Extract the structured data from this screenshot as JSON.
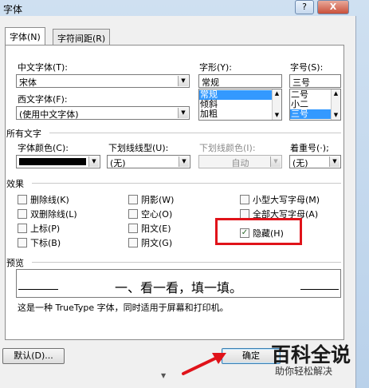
{
  "window": {
    "title": "字体",
    "help_button": "?",
    "close_button": "X"
  },
  "tabs": [
    {
      "label": "字体(N)",
      "active": true
    },
    {
      "label": "字符间距(R)",
      "active": false
    }
  ],
  "font": {
    "chinese_font_label": "中文字体(T):",
    "chinese_font_value": "宋体",
    "western_font_label": "西文字体(F):",
    "western_font_value": "(使用中文字体)",
    "style_label": "字形(Y):",
    "style_value": "常规",
    "style_options": [
      "常规",
      "倾斜",
      "加粗"
    ],
    "style_selected": 0,
    "size_label": "字号(S):",
    "size_value": "三号",
    "size_options": [
      "二号",
      "小二",
      "三号"
    ],
    "size_selected": 2
  },
  "all_text": {
    "section_label": "所有文字",
    "font_color_label": "字体颜色(C):",
    "font_color_value": "#000000",
    "underline_style_label": "下划线线型(U):",
    "underline_style_value": "(无)",
    "underline_color_label": "下划线颜色(I):",
    "underline_color_value": "自动",
    "emphasis_label": "着重号(·);",
    "emphasis_value": "(无)"
  },
  "effects": {
    "section_label": "效果",
    "items": [
      {
        "label": "删除线(K)",
        "checked": false
      },
      {
        "label": "双删除线(L)",
        "checked": false
      },
      {
        "label": "上标(P)",
        "checked": false
      },
      {
        "label": "下标(B)",
        "checked": false
      },
      {
        "label": "阴影(W)",
        "checked": false
      },
      {
        "label": "空心(O)",
        "checked": false
      },
      {
        "label": "阳文(E)",
        "checked": false
      },
      {
        "label": "阴文(G)",
        "checked": false
      },
      {
        "label": "小型大写字母(M)",
        "checked": false
      },
      {
        "label": "全部大写字母(A)",
        "checked": false
      },
      {
        "label": "隐藏(H)",
        "checked": true
      }
    ],
    "check_mark": "✓"
  },
  "preview": {
    "section_label": "预览",
    "sample_text": "一、看一看，填一填。",
    "note": "这是一种 TrueType 字体，同时适用于屏幕和打印机。"
  },
  "buttons": {
    "default_label": "默认(D)...",
    "ok_label": "确定"
  },
  "watermark": {
    "main": "百科全说",
    "sub": "助你轻松解决"
  },
  "colors": {
    "highlight": "#e0131a",
    "selection": "#3399ff"
  }
}
